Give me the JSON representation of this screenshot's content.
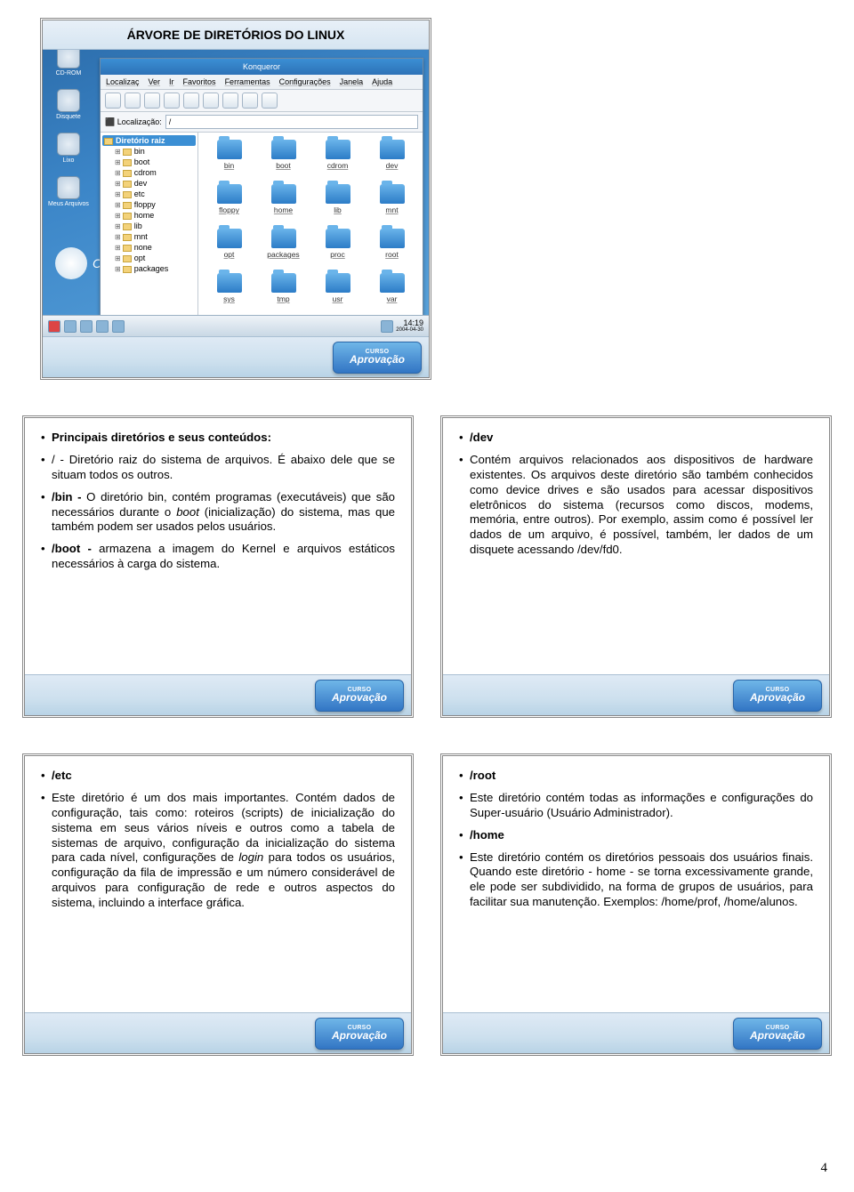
{
  "page_number": "4",
  "aprovacao_btn": {
    "small": "CURSO",
    "label": "Aprovação"
  },
  "slide1": {
    "title": "ÁRVORE DE DIRETÓRIOS DO LINUX",
    "konqueror_title": "Konqueror",
    "menubar": [
      "Localizaç",
      "Ver",
      "Ir",
      "Favoritos",
      "Ferramentas",
      "Configurações",
      "Janela",
      "Ajuda"
    ],
    "location_label": "Localização:",
    "location_value": "/",
    "tree_root": "Diretório raiz",
    "tree_items": [
      "bin",
      "boot",
      "cdrom",
      "dev",
      "etc",
      "floppy",
      "home",
      "lib",
      "mnt",
      "none",
      "opt",
      "packages"
    ],
    "icon_items": [
      "bin",
      "boot",
      "cdrom",
      "dev",
      "floppy",
      "home",
      "lib",
      "mnt",
      "opt",
      "packages",
      "proc",
      "root",
      "sys",
      "tmp",
      "usr",
      "var"
    ],
    "desktop_icons": [
      "CD-ROM",
      "Disquete",
      "Lixo",
      "Meus Arquivos"
    ],
    "conectiva": "Conectiva",
    "clock": "14:19",
    "date": "2004-04-30"
  },
  "slide2": {
    "heading": "Principais diretórios e seus conteúdos:",
    "item_root": "/ - Diretório raiz do sistema de arquivos. É abaixo dele que se situam todos os outros.",
    "item_bin_prefix": "/bin - ",
    "item_bin_text_a": "O diretório bin, contém programas (executáveis) que são necessários durante o ",
    "item_bin_ital": "boot",
    "item_bin_text_b": " (inicialização) do sistema, mas que também podem ser usados pelos usuários.",
    "item_boot_prefix": "/boot - ",
    "item_boot_text": "armazena a imagem do Kernel e arquivos estáticos necessários à carga do sistema."
  },
  "slide3": {
    "title": "/dev",
    "body": "Contém arquivos relacionados aos dispositivos de hardware existentes. Os arquivos deste diretório são também conhecidos como device drives e são usados para acessar dispositivos eletrônicos do sistema (recursos como discos, modems, memória, entre outros). Por exemplo, assim como é possível ler dados de um arquivo, é possível, também, ler dados de um disquete acessando /dev/fd0."
  },
  "slide4": {
    "title": "/etc",
    "body_a": "Este diretório é um dos mais importantes. Contém dados de configuração, tais como: roteiros (scripts) de inicialização do sistema em seus vários níveis e outros como a tabela de sistemas de arquivo, configuração da inicialização do sistema para cada nível, configurações de ",
    "body_ital": "login",
    "body_b": " para todos os usuários, configuração da fila de impressão e um número considerável de arquivos para configuração de rede e outros aspectos do sistema, incluindo a interface gráfica."
  },
  "slide5": {
    "title_root": "/root",
    "body_root": "Este diretório contém todas as informações e configurações do Super-usuário (Usuário Administrador).",
    "title_home": "/home",
    "body_home": "Este diretório contém os diretórios pessoais dos usuários finais. Quando este diretório - home - se torna excessivamente grande, ele pode ser subdividido, na forma de grupos de usuários, para facilitar sua manutenção. Exemplos: /home/prof, /home/alunos."
  }
}
